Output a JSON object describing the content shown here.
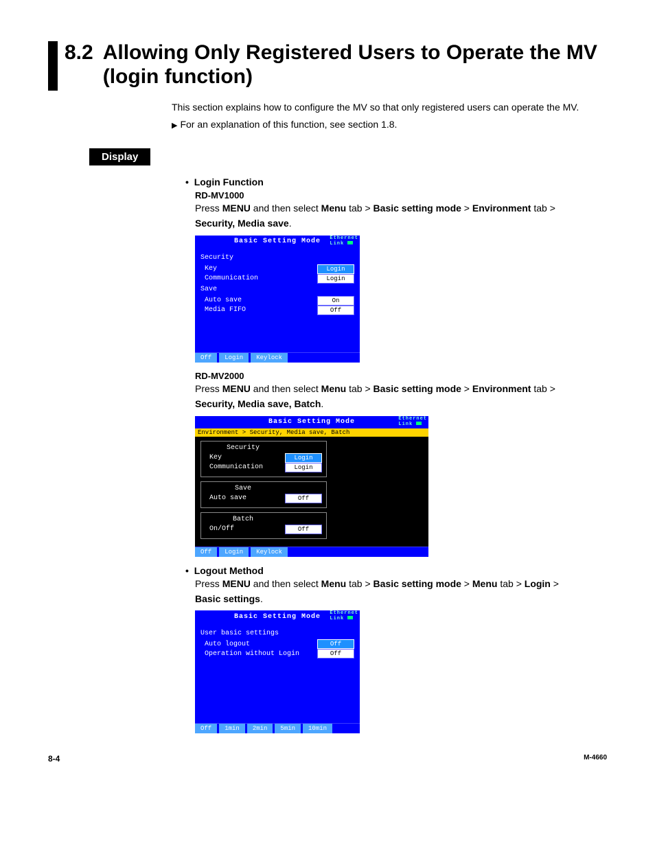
{
  "header": {
    "section_number": "8.2",
    "section_title": "Allowing Only Registered Users to Operate the MV (login function)",
    "intro": "This section explains how to configure the MV so that only registered users can operate the MV.",
    "crossref": "For an explanation of this function, see section 1.8."
  },
  "display_badge": "Display",
  "login_function": {
    "heading": "Login Function",
    "mv1000": {
      "model": "RD-MV1000",
      "instr_prefix": "Press ",
      "menu": "MENU",
      "instr_mid1": " and then select ",
      "b1": "Menu",
      "t1": " tab > ",
      "b2": "Basic setting mode",
      "t2": " > ",
      "b3": "Environment",
      "t3": " tab > ",
      "b4": "Security, Media save",
      "t4": "."
    },
    "shot1": {
      "title": "Basic Setting Mode",
      "eth1": "Ethernet",
      "eth2": "Link",
      "group1": "Security",
      "row1_label": "Key",
      "row1_val": "Login",
      "row2_label": "Communication",
      "row2_val": "Login",
      "group2": "Save",
      "row3_label": "Auto save",
      "row3_val": "On",
      "row4_label": "Media FIFO",
      "row4_val": "Off",
      "btn1": "Off",
      "btn2": "Login",
      "btn3": "Keylock"
    },
    "mv2000": {
      "model": "RD-MV2000",
      "b4": "Security, Media save, Batch"
    },
    "shot2": {
      "title": "Basic Setting Mode",
      "bread": "Environment > Security, Media save, Batch",
      "g1": "Security",
      "r1l": "Key",
      "r1v": "Login",
      "r2l": "Communication",
      "r2v": "Login",
      "g2": "Save",
      "r3l": "Auto save",
      "r3v": "Off",
      "g3": "Batch",
      "r4l": "On/Off",
      "r4v": "Off",
      "btn1": "Off",
      "btn2": "Login",
      "btn3": "Keylock"
    }
  },
  "logout": {
    "heading": "Logout Method",
    "instr_prefix": "Press ",
    "menu": "MENU",
    "t0": " and then select ",
    "b1": "Menu",
    "t1": " tab > ",
    "b2": "Basic setting mode",
    "t2": " > ",
    "b3": "Menu",
    "t3": " tab > ",
    "b4": "Login",
    "t4": " > ",
    "b5": "Basic settings",
    "t5": ".",
    "shot": {
      "title": "Basic Setting Mode",
      "eth1": "Ethernet",
      "eth2": "Link",
      "group": "User basic settings",
      "r1l": "Auto logout",
      "r1v": "Off",
      "r2l": "Operation without Login",
      "r2v": "Off",
      "btn1": "Off",
      "btn2": "1min",
      "btn3": "2min",
      "btn4": "5min",
      "btn5": "10min"
    }
  },
  "footer": {
    "page": "8-4",
    "doc": "M-4660"
  }
}
